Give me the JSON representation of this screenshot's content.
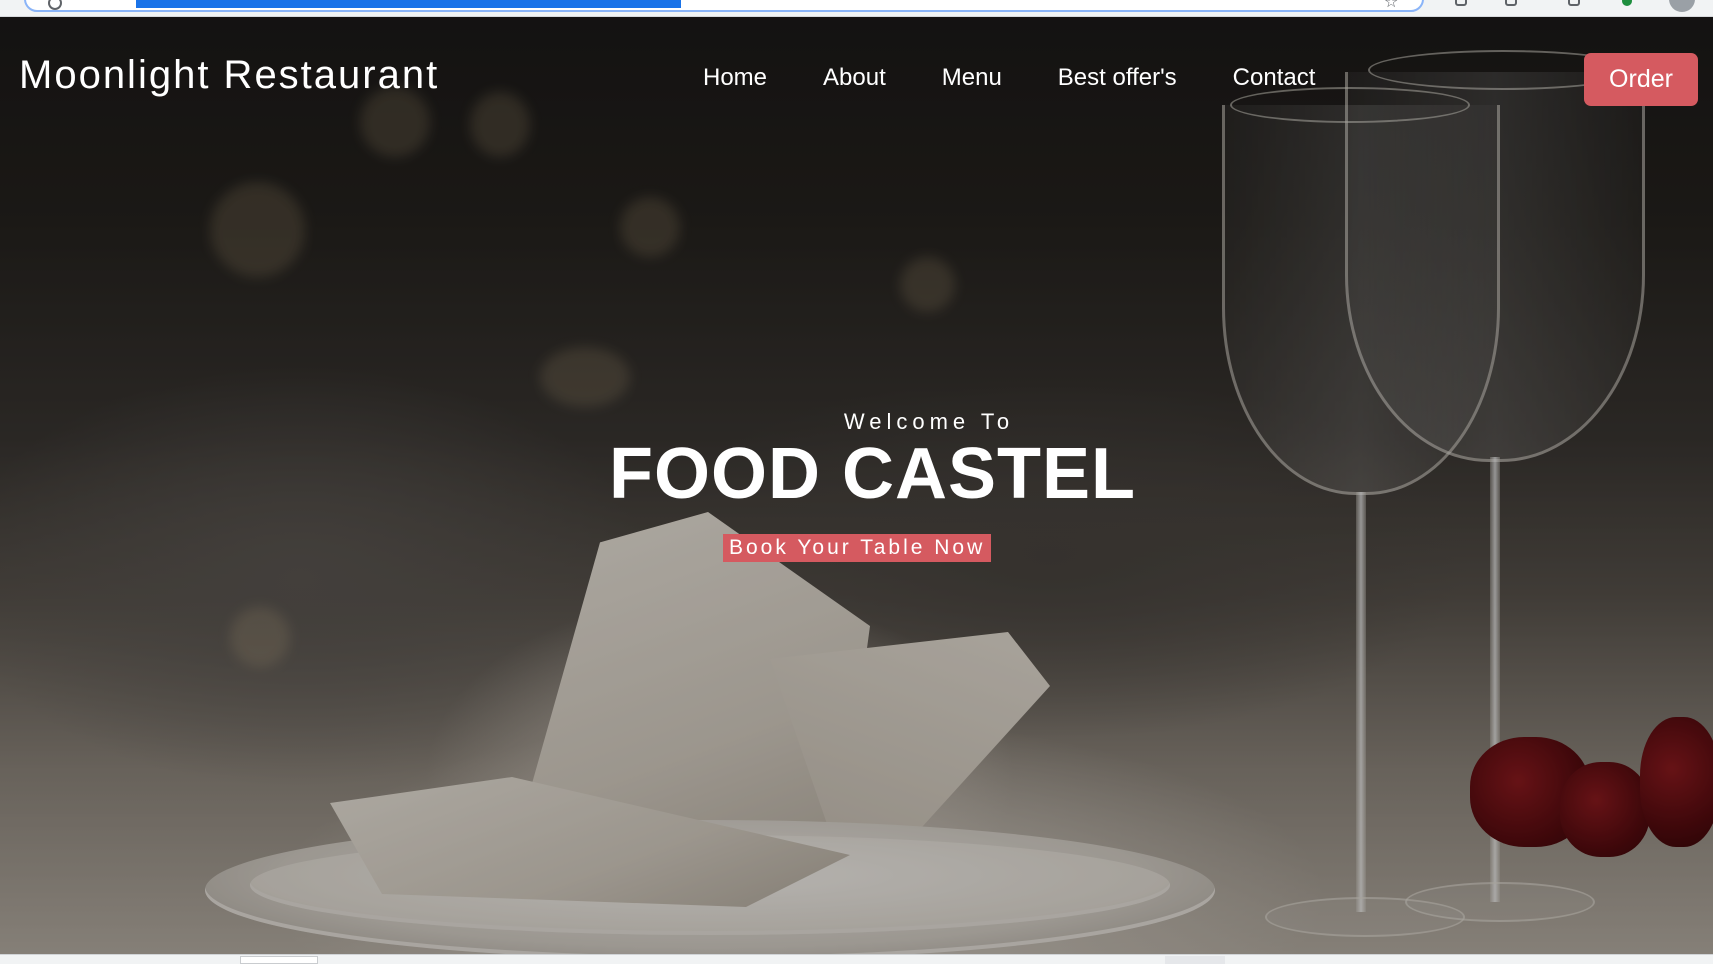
{
  "browser": {
    "icons": [
      "reload-icon",
      "bookmark-star-icon",
      "extension-icon",
      "profile-avatar"
    ]
  },
  "header": {
    "brand": "Moonlight Restaurant",
    "nav": [
      {
        "label": "Home"
      },
      {
        "label": "About"
      },
      {
        "label": "Menu"
      },
      {
        "label": "Best offer's"
      },
      {
        "label": "Contact"
      }
    ],
    "order_label": "Order"
  },
  "hero": {
    "welcome": "Welcome To",
    "title": "FOOD CASTEL",
    "cta_label": "Book Your Table Now"
  },
  "colors": {
    "accent": "#d55a60",
    "text": "#ffffff"
  }
}
